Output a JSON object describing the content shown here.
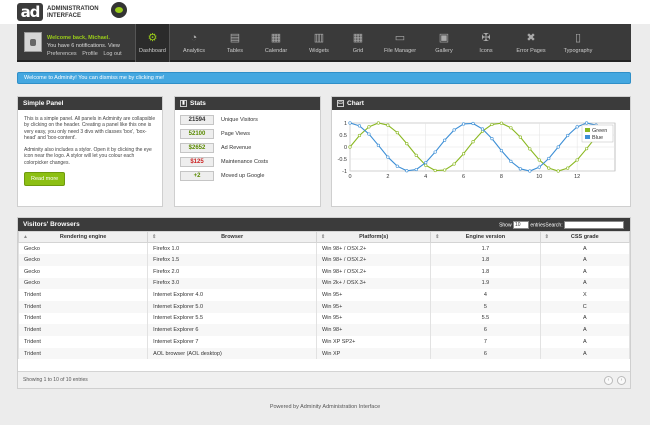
{
  "header": {
    "logo_mark": "ad",
    "logo_text": "ADMINISTRATION INTERFACE"
  },
  "user": {
    "welcome": "Welcome back, Michael.",
    "notifications": "You have 6 notifications.",
    "view": "View",
    "links": [
      "Preferences",
      "Profile",
      "Log out"
    ]
  },
  "nav": [
    {
      "label": "Dashboard",
      "icon": "gear-icon",
      "glyph": "⚙",
      "active": true
    },
    {
      "label": "Analytics",
      "icon": "clock-icon",
      "glyph": "◔"
    },
    {
      "label": "Tables",
      "icon": "table-icon",
      "glyph": "▤"
    },
    {
      "label": "Calendar",
      "icon": "calendar-icon",
      "glyph": "▦"
    },
    {
      "label": "Widgets",
      "icon": "widgets-icon",
      "glyph": "▥"
    },
    {
      "label": "Grid",
      "icon": "grid-icon",
      "glyph": "▦"
    },
    {
      "label": "File Manager",
      "icon": "folder-icon",
      "glyph": "▭"
    },
    {
      "label": "Gallery",
      "icon": "camera-icon",
      "glyph": "▣"
    },
    {
      "label": "Icons",
      "icon": "tools-icon",
      "glyph": "✠"
    },
    {
      "label": "Error Pages",
      "icon": "warning-icon",
      "glyph": "✖"
    },
    {
      "label": "Typography",
      "icon": "typography-icon",
      "glyph": "▯"
    }
  ],
  "notice": "Welcome to Adminity! You can dismiss me by clicking me!",
  "simple_panel": {
    "title": "Simple Panel",
    "p1": "This is a simple panel. All panels in Adminity are collapsible by clicking on the header. Creating a panel like this one is very easy, you only need 3 divs with classes 'box', 'box-head' and 'box-content'.",
    "p2": "Adminity also includes a stylor. Open it by clicking the eye icon near the logo. A stylor will let you colour each colorpicker changes.",
    "button": "Read more"
  },
  "stats": {
    "title": "Stats",
    "rows": [
      {
        "value": "21594",
        "label": "Unique Visitors",
        "color": "#333333"
      },
      {
        "value": "52100",
        "label": "Page Views",
        "color": "#5a8a00"
      },
      {
        "value": "$2652",
        "label": "Ad Revenue",
        "color": "#5a8a00"
      },
      {
        "value": "$125",
        "label": "Maintenance Costs",
        "color": "#cc2222"
      },
      {
        "value": "+2",
        "label": "Moved up Google",
        "color": "#5a8a00"
      }
    ]
  },
  "chart_panel": {
    "title": "Chart"
  },
  "chart_data": {
    "type": "line",
    "x": [
      0,
      0.5,
      1,
      1.5,
      2,
      2.5,
      3,
      3.5,
      4,
      4.5,
      5,
      5.5,
      6,
      6.5,
      7,
      7.5,
      8,
      8.5,
      9,
      9.5,
      10,
      10.5,
      11,
      11.5,
      12,
      12.5,
      13,
      13.5
    ],
    "series": [
      {
        "name": "Green",
        "color": "#8ab821",
        "values": [
          0,
          0.48,
          0.84,
          1.0,
          0.91,
          0.6,
          0.14,
          -0.35,
          -0.76,
          -0.98,
          -0.96,
          -0.71,
          -0.28,
          0.22,
          0.66,
          0.94,
          0.99,
          0.8,
          0.41,
          -0.08,
          -0.54,
          -0.88,
          -1.0,
          -0.88,
          -0.54,
          -0.07,
          0.42,
          0.8
        ]
      },
      {
        "name": "Blue",
        "color": "#3d8fd6",
        "values": [
          1.0,
          0.88,
          0.54,
          0.07,
          -0.42,
          -0.8,
          -0.99,
          -0.94,
          -0.65,
          -0.21,
          0.28,
          0.71,
          0.96,
          0.98,
          0.75,
          0.35,
          -0.15,
          -0.6,
          -0.91,
          -1.0,
          -0.84,
          -0.48,
          0.0,
          0.48,
          0.84,
          1.0,
          0.91,
          0.6
        ]
      }
    ],
    "xticks": [
      0,
      2,
      4,
      6,
      8,
      10,
      12
    ],
    "yticks": [
      1.0,
      0.5,
      0.0,
      -0.5,
      -1.0
    ],
    "xlim": [
      0,
      14
    ],
    "ylim": [
      -1.0,
      1.0
    ],
    "grid": true,
    "legend": "top-right"
  },
  "browsers": {
    "title": "Visitors' Browsers",
    "show_label": "Show",
    "show_value": "10",
    "entries_label": "entries",
    "search_label": "Search:",
    "columns": [
      "Rendering engine",
      "Browser",
      "Platform(s)",
      "Engine version",
      "CSS grade"
    ],
    "rows": [
      [
        "Gecko",
        "Firefox 1.0",
        "Win 98+ / OSX.2+",
        "1.7",
        "A"
      ],
      [
        "Gecko",
        "Firefox 1.5",
        "Win 98+ / OSX.2+",
        "1.8",
        "A"
      ],
      [
        "Gecko",
        "Firefox 2.0",
        "Win 98+ / OSX.2+",
        "1.8",
        "A"
      ],
      [
        "Gecko",
        "Firefox 3.0",
        "Win 2k+ / OSX.3+",
        "1.9",
        "A"
      ],
      [
        "Trident",
        "Internet Explorer 4.0",
        "Win 95+",
        "4",
        "X"
      ],
      [
        "Trident",
        "Internet Explorer 5.0",
        "Win 95+",
        "5",
        "C"
      ],
      [
        "Trident",
        "Internet Explorer 5.5",
        "Win 95+",
        "5.5",
        "A"
      ],
      [
        "Trident",
        "Internet Explorer 6",
        "Win 98+",
        "6",
        "A"
      ],
      [
        "Trident",
        "Internet Explorer 7",
        "Win XP SP2+",
        "7",
        "A"
      ],
      [
        "Trident",
        "AOL browser (AOL desktop)",
        "Win XP",
        "6",
        "A"
      ]
    ],
    "info": "Showing 1 to 10 of 10 entries"
  },
  "footer": "Powered by Adminity Administration Interface"
}
